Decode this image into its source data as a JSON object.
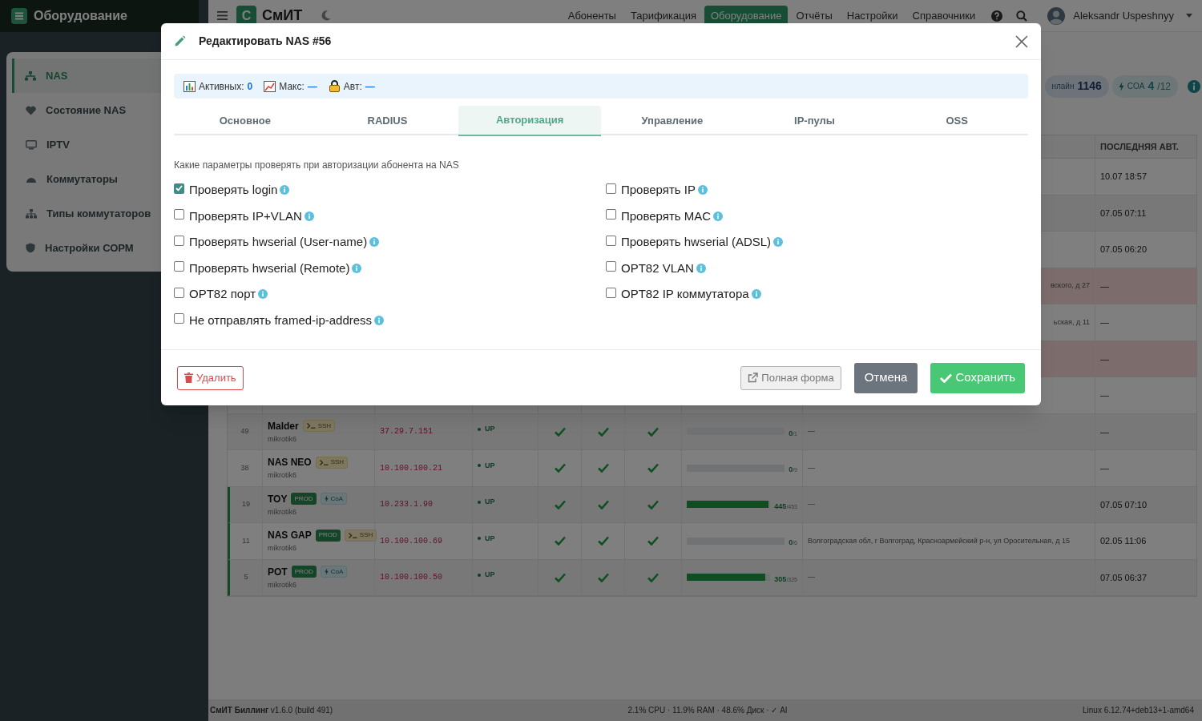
{
  "app": {
    "section_title": "Оборудование",
    "logo_letter": "С",
    "brand": "СмИТ"
  },
  "nav": [
    {
      "label": "Абоненты",
      "selected": false
    },
    {
      "label": "Тарификация",
      "selected": false
    },
    {
      "label": "Оборудование",
      "selected": true
    },
    {
      "label": "Отчёты",
      "selected": false
    },
    {
      "label": "Настройки",
      "selected": false
    },
    {
      "label": "Справочники",
      "selected": false
    }
  ],
  "user": {
    "name": "Aleksandr Uspeshnyy"
  },
  "sidebar": {
    "items": [
      {
        "label": "NAS",
        "selected": true
      },
      {
        "label": "Состояние NAS",
        "selected": false
      },
      {
        "label": "IPTV",
        "selected": false
      },
      {
        "label": "Коммутаторы",
        "selected": false
      },
      {
        "label": "Типы коммутаторов",
        "selected": false
      },
      {
        "label": "Настройки СОРМ",
        "selected": false
      }
    ]
  },
  "stats": [
    {
      "kind": "online",
      "label": "нлайн",
      "value": "1146"
    },
    {
      "kind": "coa",
      "label": "COA",
      "value": "4",
      "total": "/12"
    }
  ],
  "table": {
    "last_auth_header": "ПОСЛЕДНЯЯ АВТ.",
    "rows": [
      {
        "kind": "covered",
        "alert": false,
        "last_auth": "10.07 18:57"
      },
      {
        "kind": "covered",
        "alert": false,
        "last_auth": "07.05 07:11"
      },
      {
        "kind": "covered",
        "alert": false,
        "last_auth": "07.05 06:20"
      },
      {
        "kind": "covered",
        "alert": true,
        "address": "вского, д 27",
        "last_auth": "—"
      },
      {
        "kind": "covered",
        "alert": false,
        "address": "ьская, д 11",
        "last_auth": "—"
      },
      {
        "kind": "covered",
        "alert": true,
        "last_auth": "—"
      },
      {
        "kind": "covered",
        "alert": false,
        "last_auth": "—"
      },
      {
        "kind": "full",
        "id": "49",
        "name": "Malder",
        "badges": [
          {
            "kind": "ssh",
            "label": "SSH"
          }
        ],
        "model": "mikrotik6",
        "ip": "37.29.7.151",
        "status": "UP",
        "checks": [
          true,
          true,
          true
        ],
        "sessions": "0",
        "capacity": "/1",
        "level": 0,
        "address": "—",
        "last_auth": "—"
      },
      {
        "kind": "full",
        "id": "38",
        "name": "NAS NEO",
        "badges": [
          {
            "kind": "ssh",
            "label": "SSH"
          }
        ],
        "model": "mikrotik6",
        "ip": "10.100.100.21",
        "status": "UP",
        "checks": [
          true,
          true,
          true
        ],
        "sessions": "0",
        "capacity": "/9",
        "level": 0,
        "address": "—",
        "last_auth": "—"
      },
      {
        "kind": "full",
        "id": "19",
        "name": "TOY",
        "badges": [
          {
            "kind": "prod",
            "label": "PROD"
          },
          {
            "kind": "coa",
            "label": "CoA"
          }
        ],
        "model": "mikrotik6",
        "ip": "10.233.1.90",
        "status": "UP",
        "checks": [
          true,
          true,
          true
        ],
        "sessions": "445",
        "capacity": "/453",
        "level": 0.98,
        "address": "—",
        "last_auth": "07.05 07:10"
      },
      {
        "kind": "full",
        "id": "11",
        "name": "NAS GAP",
        "badges": [
          {
            "kind": "prod",
            "label": "PROD"
          },
          {
            "kind": "ssh",
            "label": "SSH"
          }
        ],
        "model": "mikrotik6",
        "ip": "10.100.100.69",
        "status": "UP",
        "checks": [
          true,
          true,
          true
        ],
        "sessions": "0",
        "capacity": "/6",
        "level": 0,
        "address": "Волгоградская обл, г Волгоград, Красноармейский р-н, ул Оросительная, д 15",
        "last_auth": "02.05 11:06"
      },
      {
        "kind": "full",
        "id": "5",
        "name": "POT",
        "badges": [
          {
            "kind": "prod",
            "label": "PROD"
          },
          {
            "kind": "coa",
            "label": "CoA"
          }
        ],
        "model": "mikrotik6",
        "ip": "10.100.100.50",
        "status": "UP",
        "checks": [
          true,
          true,
          true
        ],
        "sessions": "305",
        "capacity": "/325",
        "level": 0.94,
        "address": "—",
        "last_auth": "07.05 06:37"
      }
    ]
  },
  "footer": {
    "version": "**СмИТ Биллинг** v1.6.0 (build 491)",
    "metrics": "2.1% CPU · 11.9% RAM · 48.6% Диск · ✓ AI",
    "system": "Linux 6.12.74+deb13+1-amd64"
  },
  "modal": {
    "title": "Редактировать NAS #56",
    "stats": [
      {
        "label": "Активных:",
        "value": "0"
      },
      {
        "label": "Макс:",
        "value": "—"
      },
      {
        "label": "Авт:",
        "value": "—"
      }
    ],
    "tabs": [
      {
        "label": "Основное",
        "selected": false
      },
      {
        "label": "RADIUS",
        "selected": false
      },
      {
        "label": "Авторизация",
        "selected": true
      },
      {
        "label": "Управление",
        "selected": false
      },
      {
        "label": "IP-пулы",
        "selected": false
      },
      {
        "label": "OSS",
        "selected": false
      }
    ],
    "section_label": "Какие параметры проверять при авторизации абонента на NAS",
    "left_options": [
      {
        "label": "Проверять login",
        "checked": true
      },
      {
        "label": "Проверять IP+VLAN",
        "checked": false
      },
      {
        "label": "Проверять hwserial (User-name)",
        "checked": false
      },
      {
        "label": "Проверять hwserial (Remote)",
        "checked": false
      },
      {
        "label": "OPT82 порт",
        "checked": false
      },
      {
        "label": "Не отправлять framed-ip-address",
        "checked": false
      }
    ],
    "right_options": [
      {
        "label": "Проверять IP",
        "checked": false
      },
      {
        "label": "Проверять MAC",
        "checked": false
      },
      {
        "label": "Проверять hwserial (ADSL)",
        "checked": false
      },
      {
        "label": "OPT82 VLAN",
        "checked": false
      },
      {
        "label": "OPT82 IP коммутатора",
        "checked": false
      }
    ],
    "buttons": [
      {
        "kind": "delete",
        "label": "Удалить"
      },
      {
        "kind": "full_form",
        "label": "Полная форма"
      },
      {
        "kind": "cancel",
        "label": "Отмена"
      },
      {
        "kind": "save",
        "label": "Сохранить"
      }
    ]
  }
}
